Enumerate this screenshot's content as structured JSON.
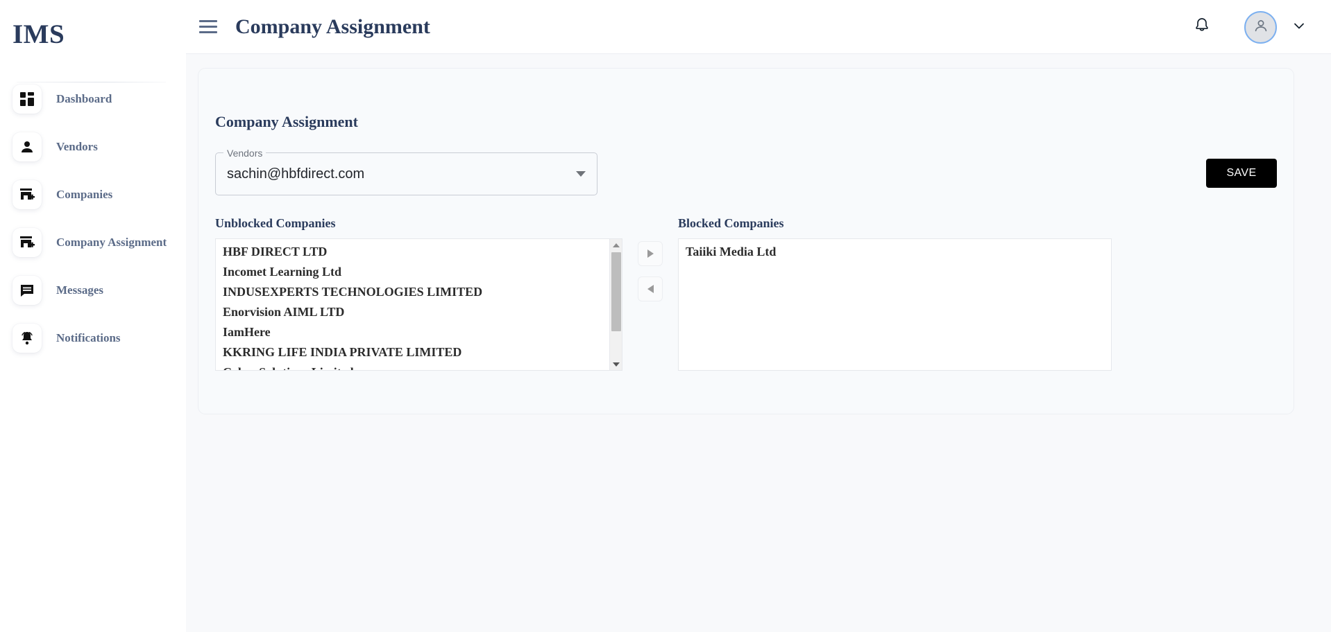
{
  "brand": {
    "logo": "IMS"
  },
  "sidebar": {
    "items": [
      {
        "label": "Dashboard",
        "icon": "dashboard-icon"
      },
      {
        "label": "Vendors",
        "icon": "person-icon"
      },
      {
        "label": "Companies",
        "icon": "store-add-icon"
      },
      {
        "label": "Company Assignment",
        "icon": "store-add-icon"
      },
      {
        "label": "Messages",
        "icon": "chat-icon"
      },
      {
        "label": "Notifications",
        "icon": "bell-icon"
      }
    ]
  },
  "header": {
    "title": "Company Assignment",
    "menu_icon": "hamburger-icon",
    "bell_icon": "bell-icon",
    "avatar_icon": "person-icon",
    "chevron_icon": "chevron-down-icon"
  },
  "card": {
    "title": "Company Assignment",
    "save_label": "SAVE",
    "vendors_field": {
      "label": "Vendors",
      "value": "sachin@hbfdirect.com",
      "arrow_icon": "caret-down-icon"
    },
    "unblocked": {
      "heading": "Unblocked Companies",
      "items": [
        "HBF DIRECT LTD",
        "Incomet Learning Ltd",
        "INDUSEXPERTS TECHNOLOGIES LIMITED",
        "Enorvision AIML LTD",
        "IamHere",
        "KKRING LIFE INDIA PRIVATE LIMITED",
        "Cyber Solutions Limited"
      ]
    },
    "blocked": {
      "heading": "Blocked Companies",
      "items": [
        "Taiiki Media Ltd"
      ]
    },
    "transfer": {
      "to_blocked_icon": "arrow-right-icon",
      "to_unblocked_icon": "arrow-left-icon"
    }
  },
  "colors": {
    "brand_navy": "#2a3b5c",
    "sidebar_text": "#5b6b88",
    "page_bg": "#f8f9fb",
    "save_bg": "#000000",
    "avatar_ring": "#7cb0f0"
  }
}
